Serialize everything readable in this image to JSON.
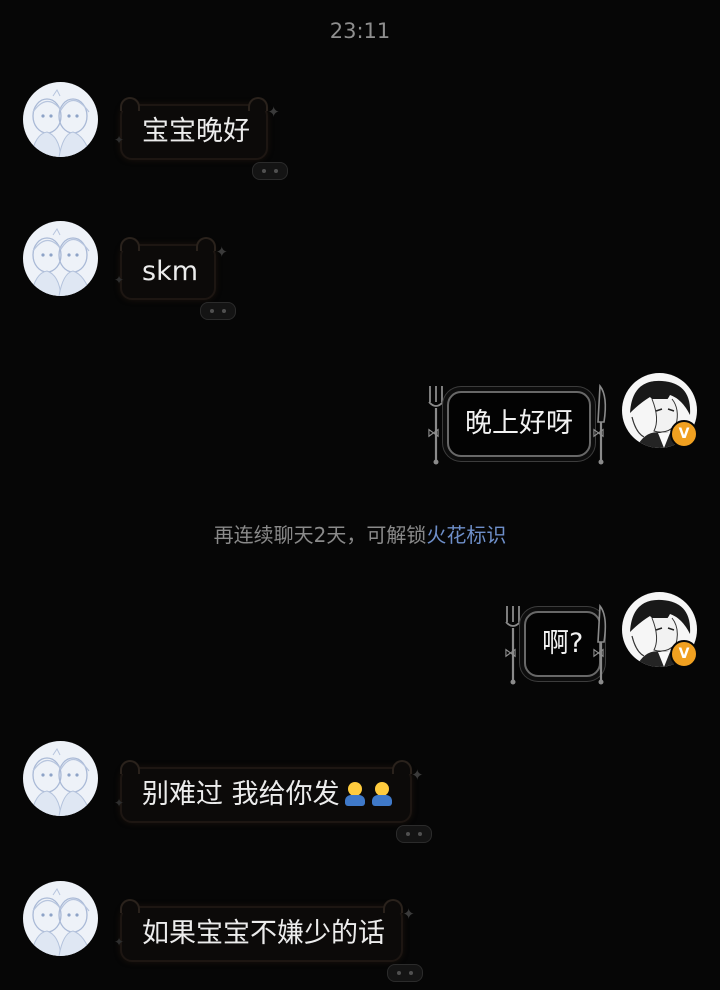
{
  "timestamp": "23:11",
  "system_notice": {
    "text": "再连续聊天2天，可解锁",
    "link": "火花标识"
  },
  "messages": [
    {
      "side": "incoming",
      "text": "宝宝晚好"
    },
    {
      "side": "incoming",
      "text": "skm"
    },
    {
      "side": "outgoing",
      "text": "晚上好呀"
    },
    {
      "side": "outgoing",
      "text": "啊?"
    },
    {
      "side": "incoming",
      "text": "别难过 我给你发",
      "emoji": [
        "hug-emoji",
        "hug-emoji"
      ]
    },
    {
      "side": "incoming",
      "text": "如果宝宝不嫌少的话"
    }
  ],
  "own_badge": "V",
  "colors": {
    "background": "#060606",
    "link_blue": "#6e8fc9",
    "badge_orange": "#f0a020"
  }
}
